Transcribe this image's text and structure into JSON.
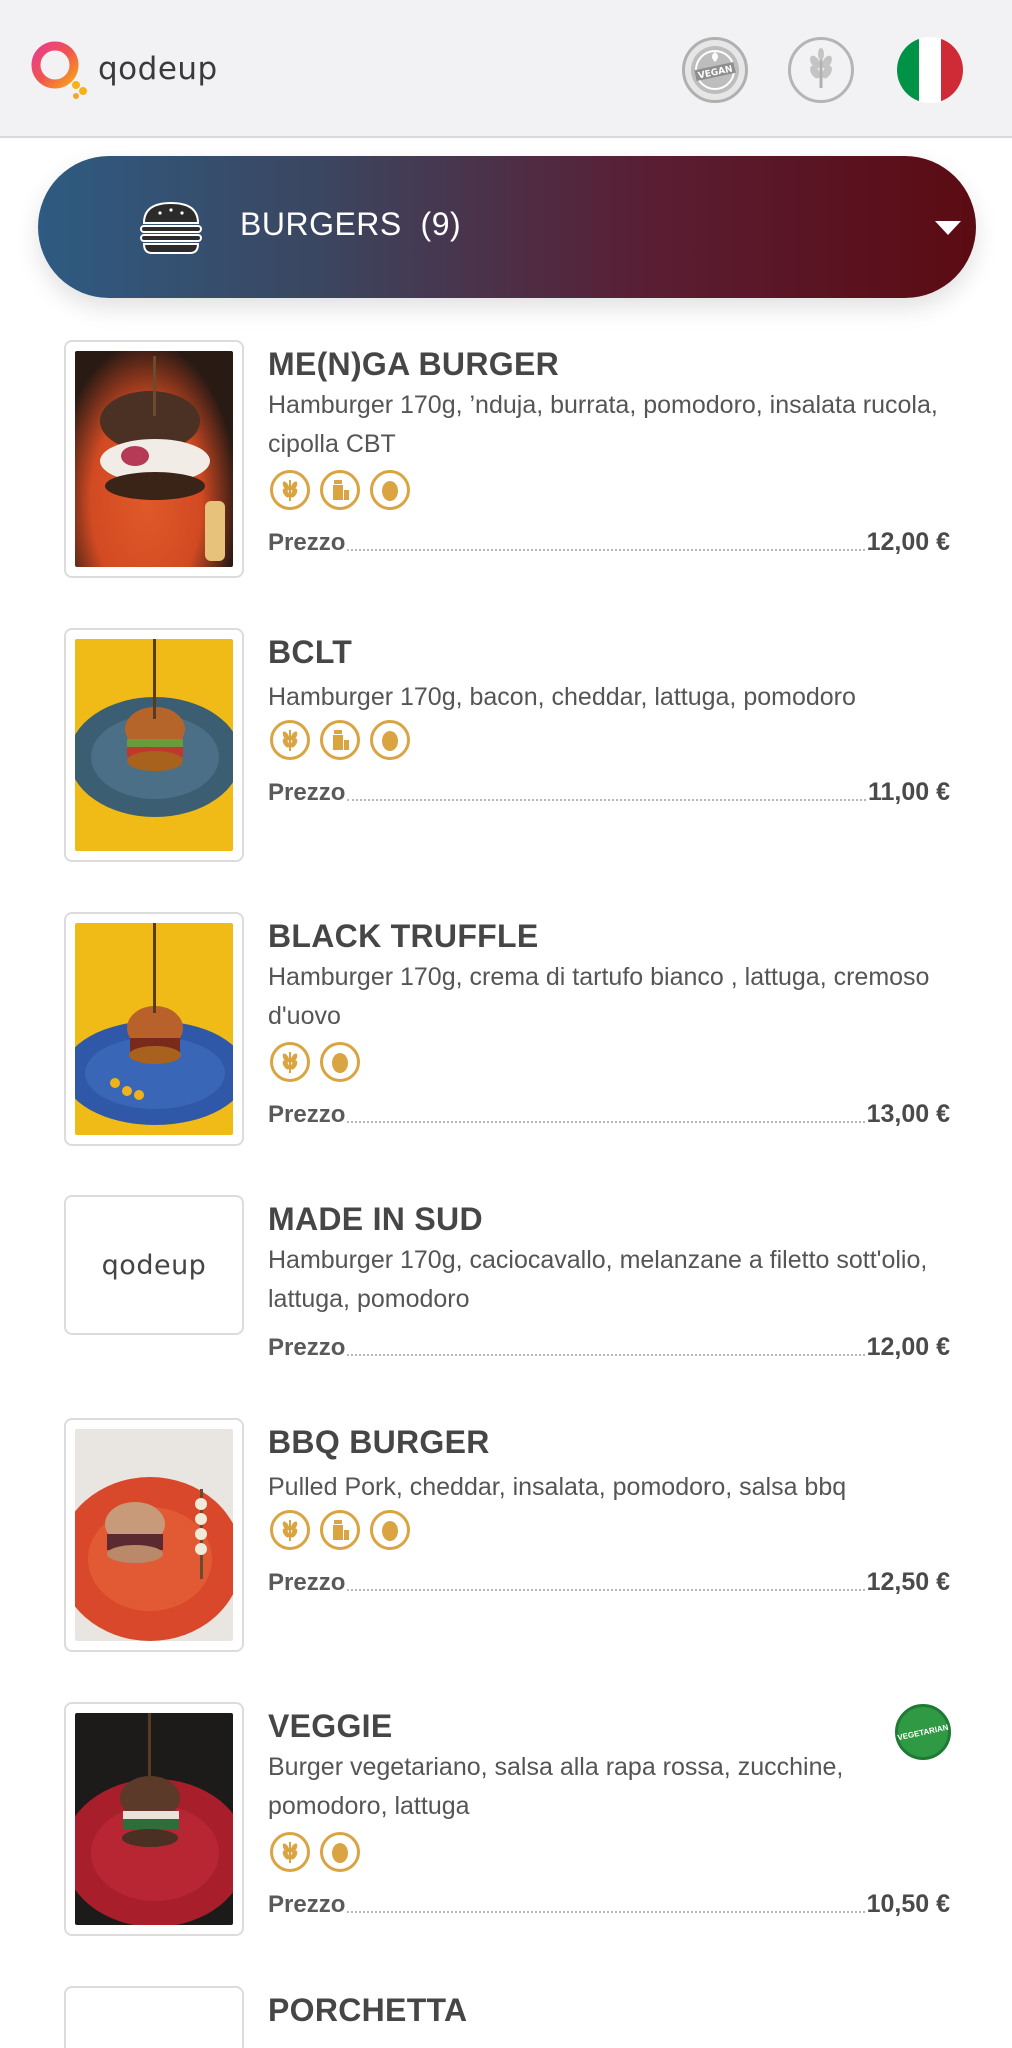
{
  "brand": {
    "name": "qodeup"
  },
  "header": {
    "vegan_badge": "VEGAN",
    "colors": {
      "flag_green": "#009246",
      "flag_white": "#ffffff",
      "flag_red": "#ce2b37"
    }
  },
  "category": {
    "icon": "burger-icon",
    "label": "BURGERS",
    "count": "(9)"
  },
  "items": [
    {
      "name": "ME(N)GA BURGER",
      "description": "Hamburger 170g, ’nduja, burrata, pomodoro, insalata rucola, cipolla CBT",
      "allergens": [
        "gluten-icon",
        "milk-icon",
        "egg-icon"
      ],
      "price_label": "Prezzo",
      "price": "12,00 €"
    },
    {
      "name": "BCLT",
      "description": "Hamburger 170g, bacon, cheddar, lattuga, pomodoro",
      "allergens": [
        "gluten-icon",
        "milk-icon",
        "egg-icon"
      ],
      "price_label": "Prezzo",
      "price": "11,00 €"
    },
    {
      "name": "BLACK TRUFFLE",
      "description": "Hamburger 170g, crema di tartufo bianco , lattuga, cremoso d'uovo",
      "allergens": [
        "gluten-icon",
        "egg-icon"
      ],
      "price_label": "Prezzo",
      "price": "13,00 €"
    },
    {
      "name": "MADE IN SUD",
      "description": "Hamburger 170g, caciocavallo, melanzane a filetto sott'olio, lattuga, pomodoro",
      "allergens": [],
      "price_label": "Prezzo",
      "price": "12,00 €",
      "thumb_text": "qodeup"
    },
    {
      "name": "BBQ BURGER",
      "description": "Pulled Pork, cheddar, insalata, pomodoro, salsa bbq",
      "allergens": [
        "gluten-icon",
        "milk-icon",
        "egg-icon"
      ],
      "price_label": "Prezzo",
      "price": "12,50 €"
    },
    {
      "name": "VEGGIE",
      "description": "Burger vegetariano, salsa alla rapa rossa, zucchine, pomodoro, lattuga",
      "allergens": [
        "gluten-icon",
        "egg-icon"
      ],
      "price_label": "Prezzo",
      "price": "10,50 €",
      "badge": "VEGETARIAN"
    },
    {
      "name": "PORCHETTA"
    }
  ]
}
